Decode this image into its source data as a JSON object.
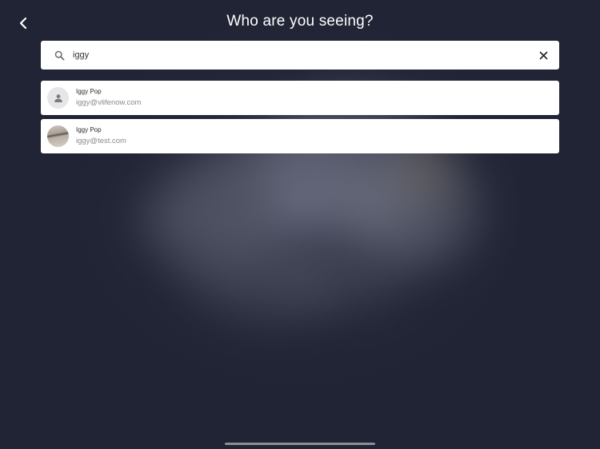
{
  "header": {
    "title": "Who are you seeing?",
    "back_icon": "chevron-left-icon"
  },
  "search": {
    "value": "iggy",
    "icon": "search-icon",
    "clear_icon": "close-icon"
  },
  "results": [
    {
      "name": "Iggy Pop",
      "email": "iggy@vlifenow.com",
      "avatar": "default-person-icon"
    },
    {
      "name": "Iggy Pop",
      "email": "iggy@test.com",
      "avatar": "photo"
    }
  ],
  "colors": {
    "background": "#24283a",
    "card": "#ffffff",
    "title": "#ffffff"
  }
}
